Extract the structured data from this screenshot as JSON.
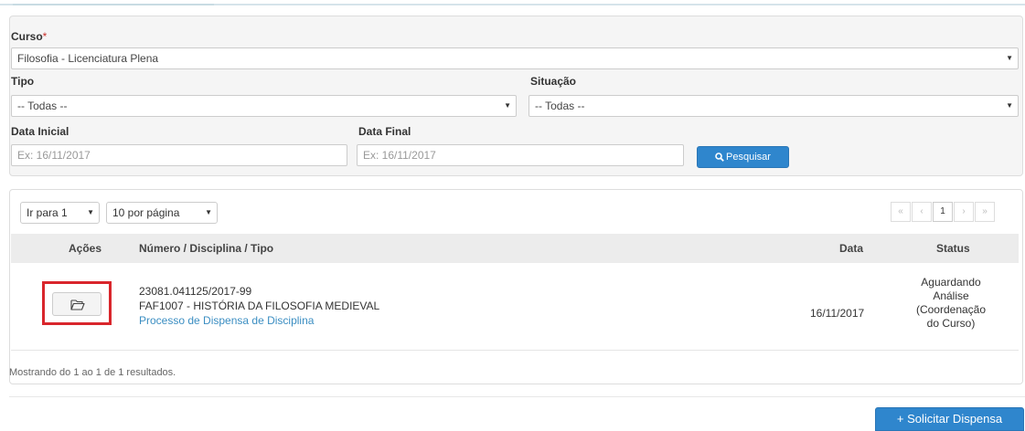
{
  "filters": {
    "curso": {
      "label": "Curso",
      "required_mark": "*",
      "value": "Filosofia - Licenciatura Plena"
    },
    "tipo": {
      "label": "Tipo",
      "value": "-- Todas --"
    },
    "situacao": {
      "label": "Situação",
      "value": "-- Todas --"
    },
    "data_inicial": {
      "label": "Data Inicial",
      "placeholder": "Ex: 16/11/2017"
    },
    "data_final": {
      "label": "Data Final",
      "placeholder": "Ex: 16/11/2017"
    },
    "search_label": "Pesquisar",
    "caret": "▼"
  },
  "results": {
    "goto_page": "Ir para 1",
    "per_page": "10 por página",
    "pager": {
      "first": "«",
      "prev": "‹",
      "current": "1",
      "next": "›",
      "last": "»"
    },
    "columns": [
      "Ações",
      "Número / Disciplina / Tipo",
      "Data",
      "Status"
    ],
    "rows": [
      {
        "numero": "23081.041125/2017-99",
        "disciplina": "FAF1007 - HISTÓRIA DA FILOSOFIA MEDIEVAL",
        "tipo": "Processo de Dispensa de Disciplina",
        "data": "16/11/2017",
        "status_lines": [
          "Aguardando",
          "Análise",
          "(Coordenação",
          "do Curso)"
        ]
      }
    ],
    "summary": "Mostrando do 1 ao 1 de 1 resultados."
  },
  "actions": {
    "solicitar_label": "+ Solicitar Dispensa"
  },
  "colors": {
    "primary": "#2f86cd",
    "highlight": "#d9262c",
    "link": "#3b8ec2"
  }
}
